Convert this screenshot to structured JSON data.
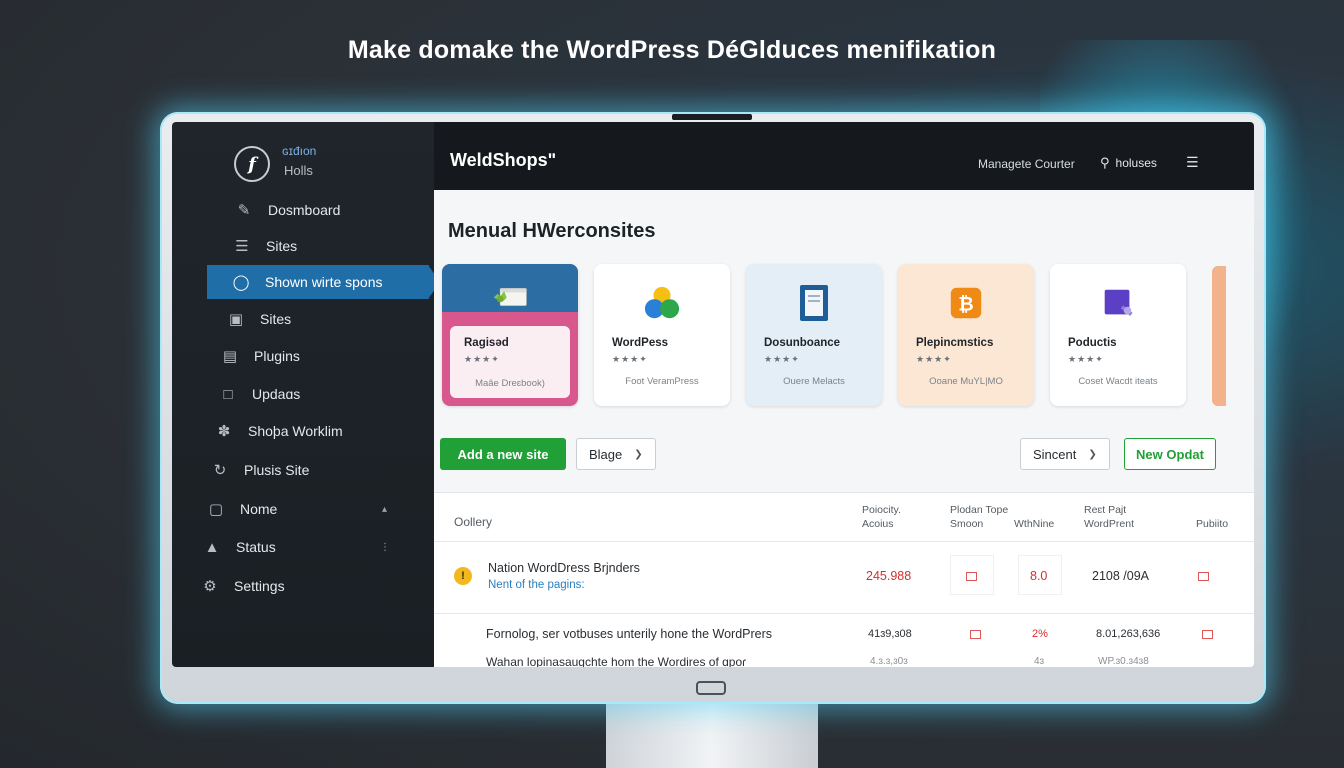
{
  "headline": "Make domake the WordPress DéGlduces menifikation",
  "sidebar": {
    "brand_name": "ɢɪđıon",
    "brand_sub": "Holls",
    "items": [
      {
        "label": "Dosmboard",
        "icon": "pencil-icon"
      },
      {
        "label": "Sites",
        "icon": "database-icon"
      },
      {
        "label": "Shown wirte spons",
        "icon": "spiral-icon",
        "active": true
      },
      {
        "label": "Sites",
        "icon": "window-icon"
      },
      {
        "label": "Plugins",
        "icon": "stack-icon"
      },
      {
        "label": "Updaɑs",
        "icon": "lock-icon"
      },
      {
        "label": "Shoþa Worklim",
        "icon": "compass-icon"
      },
      {
        "label": "Plusis Site",
        "icon": "refresh-icon"
      },
      {
        "label": "Nome",
        "icon": "monitor-icon"
      },
      {
        "label": "Status",
        "icon": "megaphone-icon"
      },
      {
        "label": "Settings",
        "icon": "gear-icon"
      }
    ]
  },
  "topbar": {
    "title": "WeldShopsʺ",
    "link": "Managete Courter",
    "search": "holuses",
    "menu_icon": "hamburger-icon"
  },
  "main": {
    "section_title": "Menual HWerconsites",
    "cards": [
      {
        "name": "Ragisəd",
        "stars": "★★★✦",
        "desc": "Maȃe Dreɛbook)"
      },
      {
        "name": "WordPess",
        "stars": "★★★✦",
        "desc": "Foot VeramPress"
      },
      {
        "name": "Dosunboance",
        "stars": "★★★✦",
        "desc": "Ouere Melacts"
      },
      {
        "name": "Plepincmstics",
        "stars": "★★★✦",
        "desc": "Ooane MuYL|MO"
      },
      {
        "name": "Poductis",
        "stars": "★★★✦",
        "desc": "Coset Wacdt iteats"
      }
    ],
    "toolbar": {
      "add_label": "Add a new site",
      "filter_label": "Blage",
      "sort_label": "Sincent",
      "new_label": "New Opdat"
    },
    "table": {
      "headers": {
        "name": "Oollery",
        "c1a": "Poiocity.",
        "c1b": "Acoius",
        "c2a": "Plodan Tope",
        "c2b": "Smoon",
        "c3": "WthNine",
        "c4a": "Reɛt Pajt",
        "c4b": "WordPrent",
        "c5": "Pubiito"
      },
      "rows": [
        {
          "title": "Nation WordDress Brjnders",
          "sub": "Nent of the pagins:",
          "v1": "245.988",
          "v3": "8.0",
          "v4": "2108 /09A"
        },
        {
          "title": "Fornolog, ser votbuses unterily hone the WordPrers",
          "v1": "41ɜ9,ɜ08",
          "v3": "2%",
          "v4": "8.01,263,636"
        },
        {
          "title": "Wahan lopinasaugchte hom the Wordires of ɑpoɾ",
          "v1": "4.ɜ.ɜ,ɜ0ɜ",
          "v3": "4ɜ",
          "v4": "WP.ɜ0.ɜ4ɜ8"
        }
      ]
    }
  },
  "colors": {
    "accent": "#1f6ea8",
    "success": "#21a038",
    "danger": "#d32f2f",
    "sidebar_bg": "#1f252b"
  }
}
